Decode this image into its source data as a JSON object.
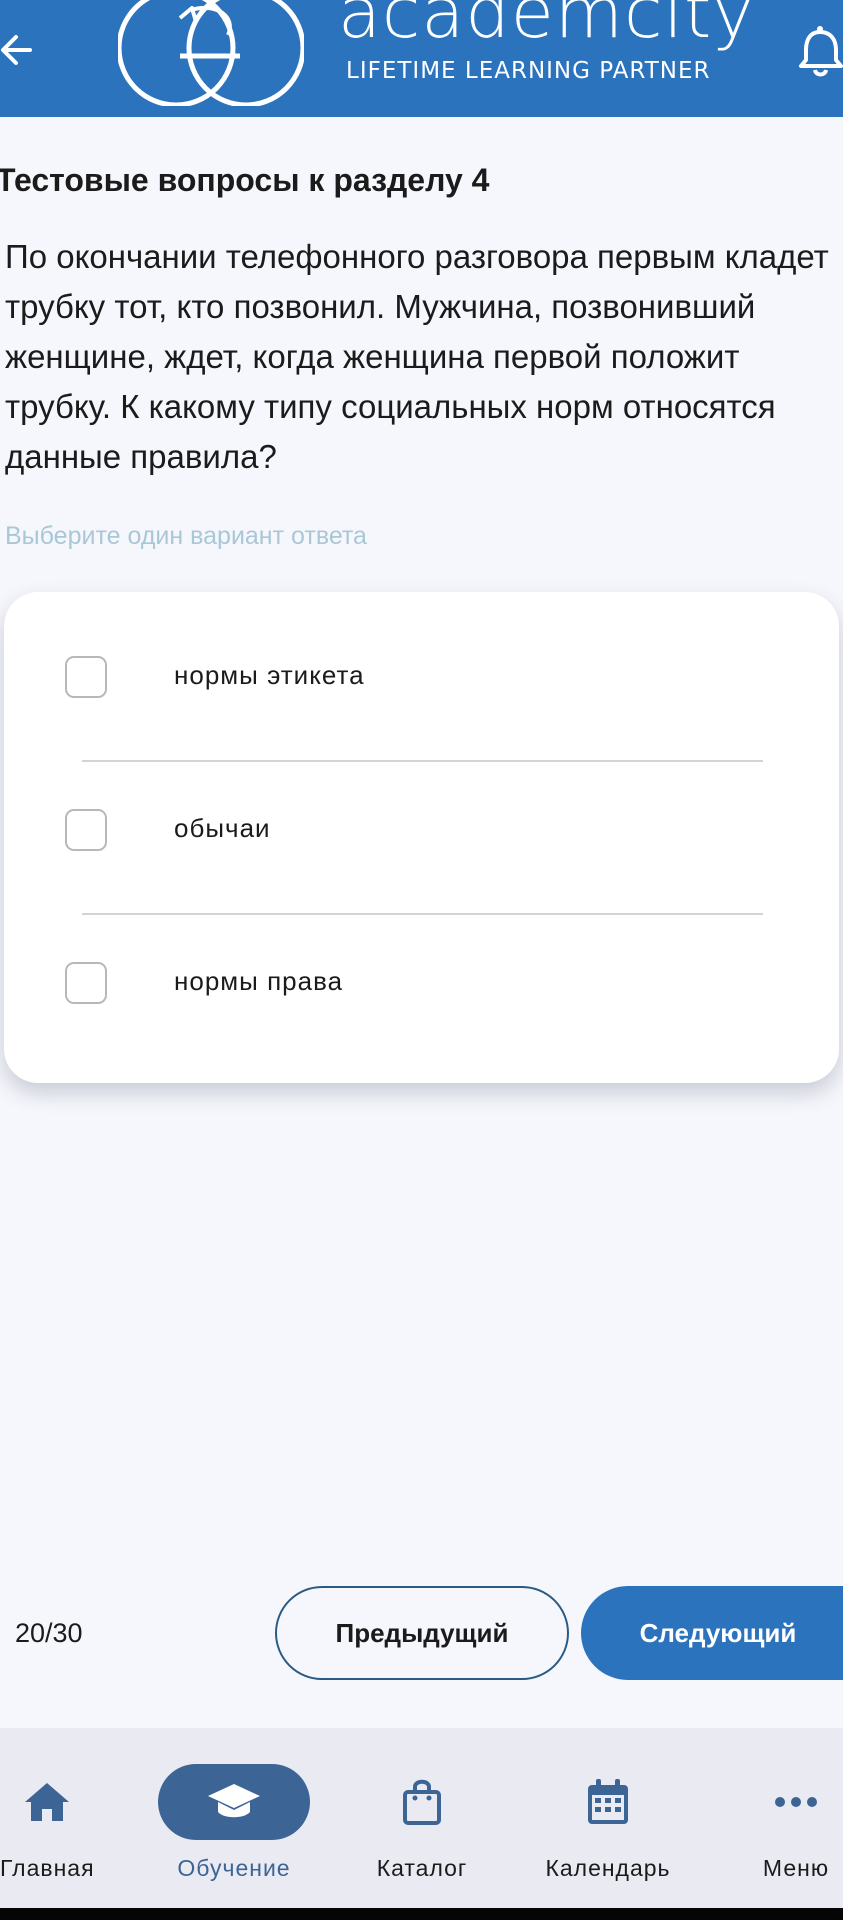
{
  "header": {
    "brand_name": "academcity",
    "tagline": "LIFETIME LEARNING PARTNER",
    "background_color": "#2c73bd",
    "icons": [
      "arrow-left-icon",
      "bell-icon"
    ]
  },
  "question": {
    "section_title": "Тестовые вопросы к разделу 4",
    "text": "По окончании телефонного разговора первым кладет трубку тот, кто позвонил. Мужчина, позвонивший женщине, ждет, когда женщина первой положит трубку. К какому типу социальных норм относятся данные правила?",
    "hint": "Выберите один вариант ответа"
  },
  "answers": [
    {
      "label": "нормы этикета",
      "checked": false
    },
    {
      "label": "обычаи",
      "checked": false
    },
    {
      "label": "нормы права",
      "checked": false
    }
  ],
  "pagination": {
    "progress": "20/30",
    "prev_label": "Предыдущий",
    "next_label": "Следующий",
    "accent_color": "#2c73bd"
  },
  "bottom_nav": {
    "active": "Обучение",
    "items": [
      {
        "label": "Главная",
        "icon": "home-icon"
      },
      {
        "label": "Обучение",
        "icon": "graduation-cap-icon"
      },
      {
        "label": "Каталог",
        "icon": "shopping-bag-icon"
      },
      {
        "label": "Календарь",
        "icon": "calendar-icon"
      },
      {
        "label": "Меню",
        "icon": "more-horizontal-icon"
      }
    ]
  }
}
